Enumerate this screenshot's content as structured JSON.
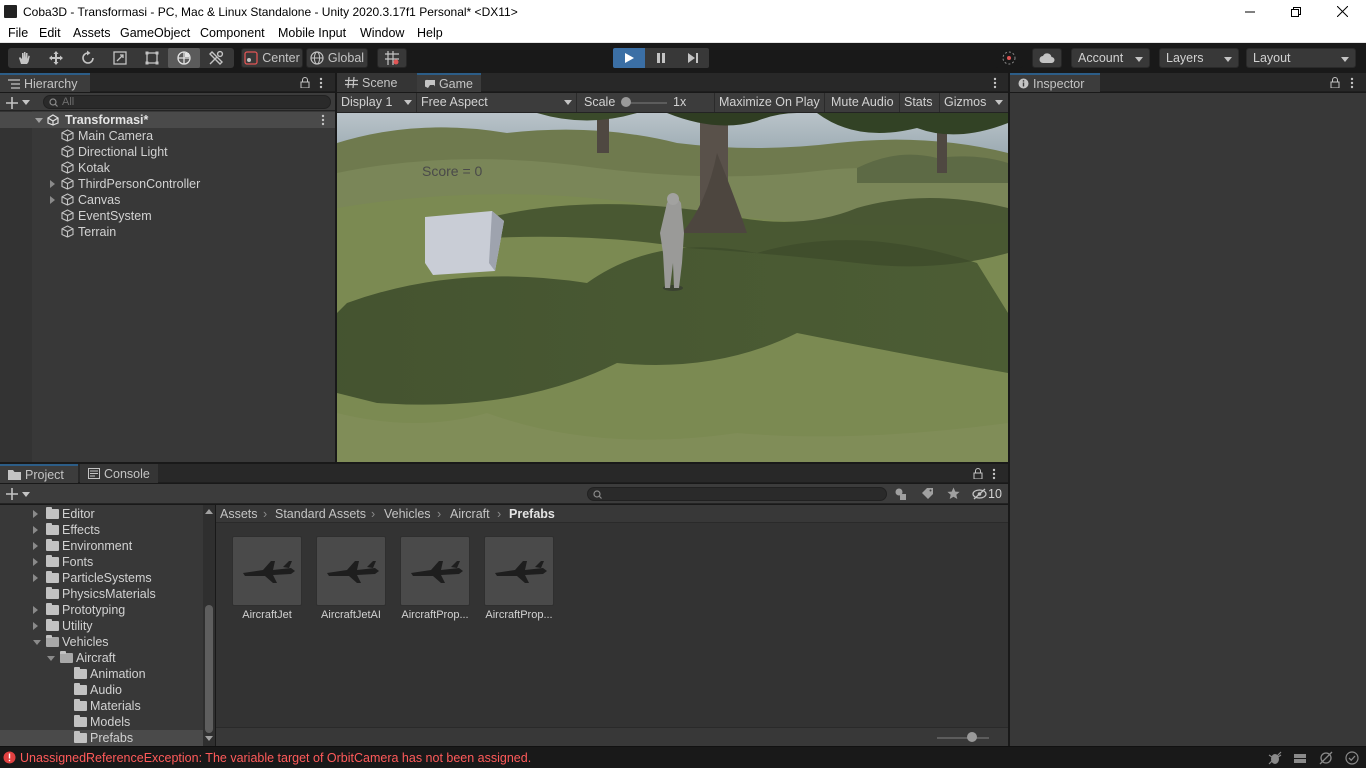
{
  "window": {
    "title": "Coba3D - Transformasi - PC, Mac & Linux Standalone - Unity 2020.3.17f1 Personal* <DX11>"
  },
  "menu": [
    "File",
    "Edit",
    "Assets",
    "GameObject",
    "Component",
    "Mobile Input",
    "Window",
    "Help"
  ],
  "toolbar": {
    "tools": [
      "hand-tool",
      "move-tool",
      "rotate-tool",
      "scale-tool",
      "rect-tool",
      "transform-tool",
      "custom-tool"
    ],
    "pivot_label": "Center",
    "space_label": "Global",
    "account_label": "Account",
    "layers_label": "Layers",
    "layout_label": "Layout"
  },
  "hierarchy": {
    "tab_label": "Hierarchy",
    "search_placeholder": "All",
    "scene_name": "Transformasi*",
    "items": [
      {
        "label": "Main Camera",
        "has_children": false
      },
      {
        "label": "Directional Light",
        "has_children": false
      },
      {
        "label": "Kotak",
        "has_children": false
      },
      {
        "label": "ThirdPersonController",
        "has_children": true
      },
      {
        "label": "Canvas",
        "has_children": true
      },
      {
        "label": "EventSystem",
        "has_children": false
      },
      {
        "label": "Terrain",
        "has_children": false
      }
    ]
  },
  "game_view": {
    "tabs": [
      "Scene",
      "Game"
    ],
    "active_tab": "Game",
    "display": "Display 1",
    "aspect": "Free Aspect",
    "scale_label": "Scale",
    "scale_value": "1x",
    "maximize_label": "Maximize On Play",
    "mute_label": "Mute Audio",
    "stats_label": "Stats",
    "gizmos_label": "Gizmos",
    "score_text": "Score = 0"
  },
  "inspector": {
    "tab_label": "Inspector"
  },
  "project": {
    "tabs": [
      "Project",
      "Console"
    ],
    "hidden_count": "10",
    "breadcrumb": [
      "Assets",
      "Standard Assets",
      "Vehicles",
      "Aircraft",
      "Prefabs"
    ],
    "tree": [
      {
        "label": "Editor",
        "depth": 0,
        "fold": "closed"
      },
      {
        "label": "Effects",
        "depth": 0,
        "fold": "closed"
      },
      {
        "label": "Environment",
        "depth": 0,
        "fold": "closed"
      },
      {
        "label": "Fonts",
        "depth": 0,
        "fold": "closed"
      },
      {
        "label": "ParticleSystems",
        "depth": 0,
        "fold": "closed"
      },
      {
        "label": "PhysicsMaterials",
        "depth": 0,
        "fold": "none"
      },
      {
        "label": "Prototyping",
        "depth": 0,
        "fold": "closed"
      },
      {
        "label": "Utility",
        "depth": 0,
        "fold": "closed"
      },
      {
        "label": "Vehicles",
        "depth": 0,
        "fold": "open"
      },
      {
        "label": "Aircraft",
        "depth": 1,
        "fold": "open"
      },
      {
        "label": "Animation",
        "depth": 2,
        "fold": "none"
      },
      {
        "label": "Audio",
        "depth": 2,
        "fold": "none"
      },
      {
        "label": "Materials",
        "depth": 2,
        "fold": "none"
      },
      {
        "label": "Models",
        "depth": 2,
        "fold": "none"
      },
      {
        "label": "Prefabs",
        "depth": 2,
        "fold": "none",
        "selected": true
      }
    ],
    "assets": [
      "AircraftJet",
      "AircraftJetAI",
      "AircraftProp...",
      "AircraftProp..."
    ]
  },
  "status": {
    "message": "UnassignedReferenceException: The variable target of OrbitCamera has not been assigned.",
    "color": "#ff5a5a"
  },
  "colors": {
    "accent_blue": "#2c5d87",
    "play_active": "#3b6fa5"
  }
}
